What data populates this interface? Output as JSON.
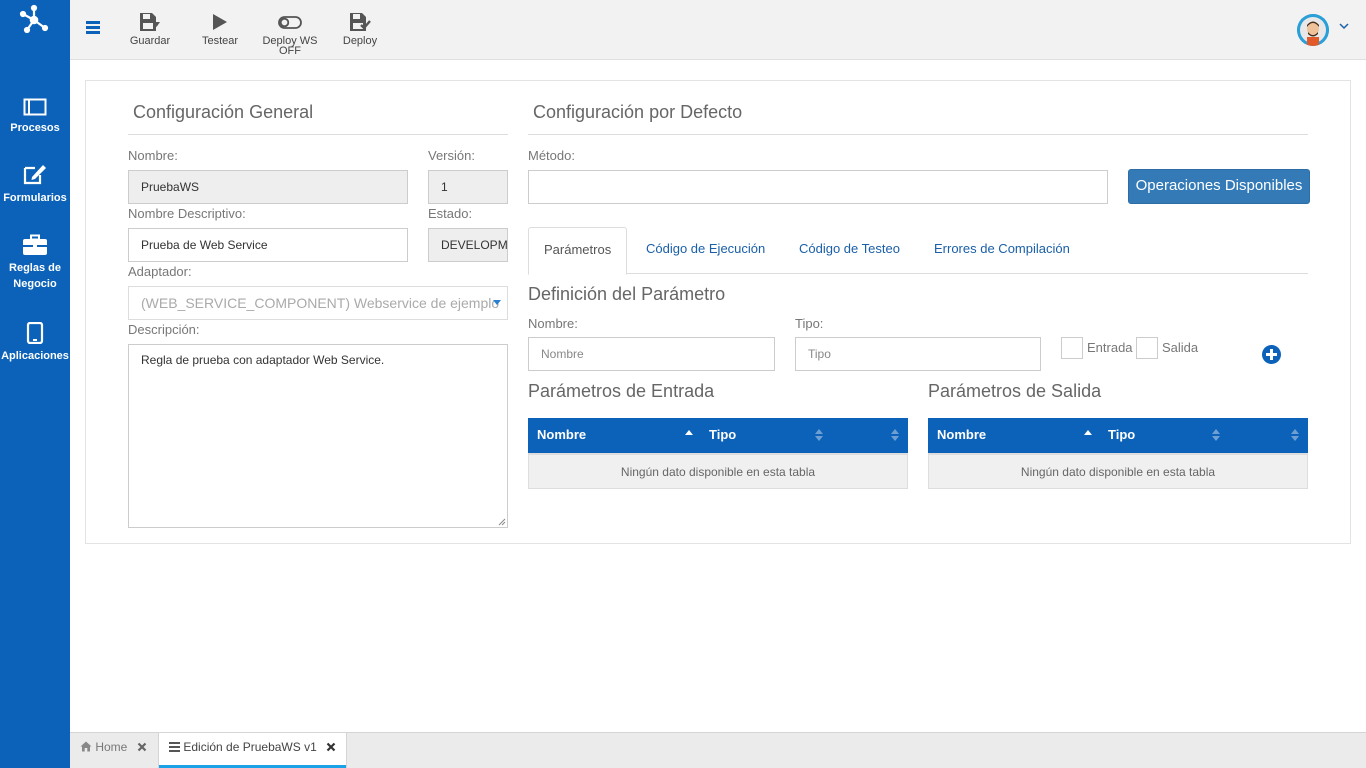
{
  "sidebar": {
    "items": [
      {
        "label": "Procesos",
        "icon": "procesos-icon"
      },
      {
        "label": "Formularios",
        "icon": "edit-form-icon"
      },
      {
        "label": "Reglas de Negocio",
        "icon": "briefcase-icon"
      },
      {
        "label": "Aplicaciones",
        "icon": "tablet-icon"
      }
    ]
  },
  "toolbar": {
    "guardar": "Guardar",
    "testear": "Testear",
    "deploy_ws_line1": "Deploy WS",
    "deploy_ws_line2": "OFF",
    "deploy": "Deploy"
  },
  "config_general": {
    "title": "Configuración General",
    "nombre_label": "Nombre:",
    "nombre_value": "PruebaWS",
    "version_label": "Versión:",
    "version_value": "1",
    "nombre_desc_label": "Nombre Descriptivo:",
    "nombre_desc_value": "Prueba de Web Service",
    "estado_label": "Estado:",
    "estado_value": "DEVELOPMENT",
    "adaptador_label": "Adaptador:",
    "adaptador_value": "(WEB_SERVICE_COMPONENT) Webservice de ejemplo",
    "descripcion_label": "Descripción:",
    "descripcion_value": "Regla de prueba con adaptador Web Service."
  },
  "config_defecto": {
    "title": "Configuración por Defecto",
    "metodo_label": "Método:",
    "metodo_value": "",
    "operaciones_button": "Operaciones Disponibles",
    "tabs": [
      {
        "label": "Parámetros",
        "active": true
      },
      {
        "label": "Código de Ejecución"
      },
      {
        "label": "Código de Testeo"
      },
      {
        "label": "Errores de Compilación"
      }
    ]
  },
  "parametros": {
    "definicion_title": "Definición del Parámetro",
    "nombre_label": "Nombre:",
    "nombre_placeholder": "Nombre",
    "tipo_label": "Tipo:",
    "tipo_placeholder": "Tipo",
    "entrada_label": "Entrada",
    "salida_label": "Salida",
    "entrada_title": "Parámetros de Entrada",
    "salida_title": "Parámetros de Salida",
    "col_nombre": "Nombre",
    "col_tipo": "Tipo",
    "empty_text": "Ningún dato disponible en esta tabla"
  },
  "bottom_tabs": {
    "home": "Home",
    "edicion": "Edición de PruebaWS v1"
  },
  "colors": {
    "brand": "#0b62b8",
    "button": "#337ab7",
    "tab_underline": "#1aa1e6"
  }
}
